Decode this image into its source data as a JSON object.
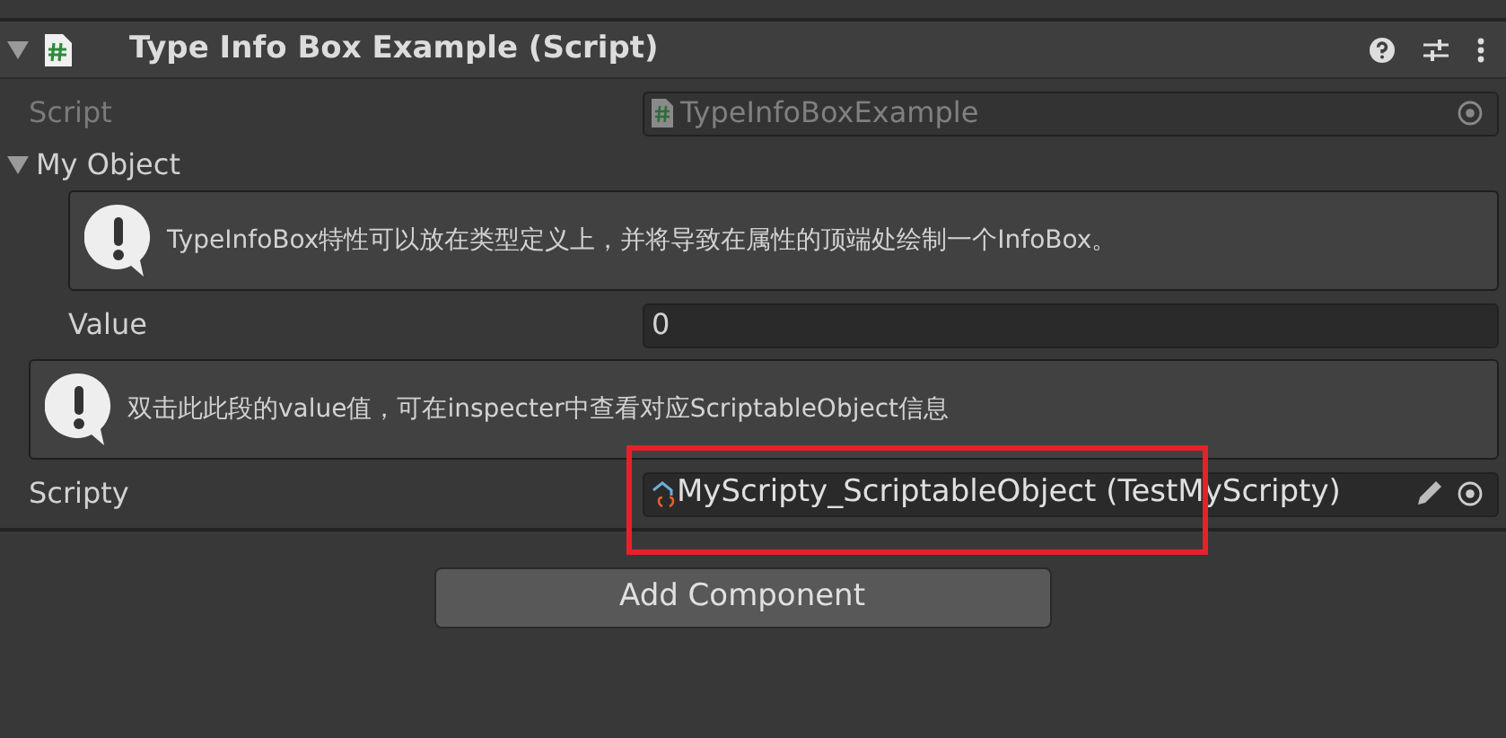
{
  "component": {
    "title": "Type Info Box Example (Script)",
    "expanded": true
  },
  "script_field": {
    "label": "Script",
    "value": "TypeInfoBoxExample",
    "disabled": true
  },
  "my_object": {
    "label": "My Object",
    "expanded": true,
    "info_box": {
      "text": "TypeInfoBox特性可以放在类型定义上，并将导致在属性的顶端处绘制一个InfoBox。"
    },
    "value_field": {
      "label": "Value",
      "value": "0"
    }
  },
  "info_box": {
    "text": "双击此此段的value值，可在inspecter中查看对应ScriptableObject信息"
  },
  "scripty_field": {
    "label": "Scripty",
    "value": "MyScripty_ScriptableObject (TestMyScripty)"
  },
  "highlight": {
    "color": "#e8202a"
  },
  "add_component_button": "Add Component"
}
